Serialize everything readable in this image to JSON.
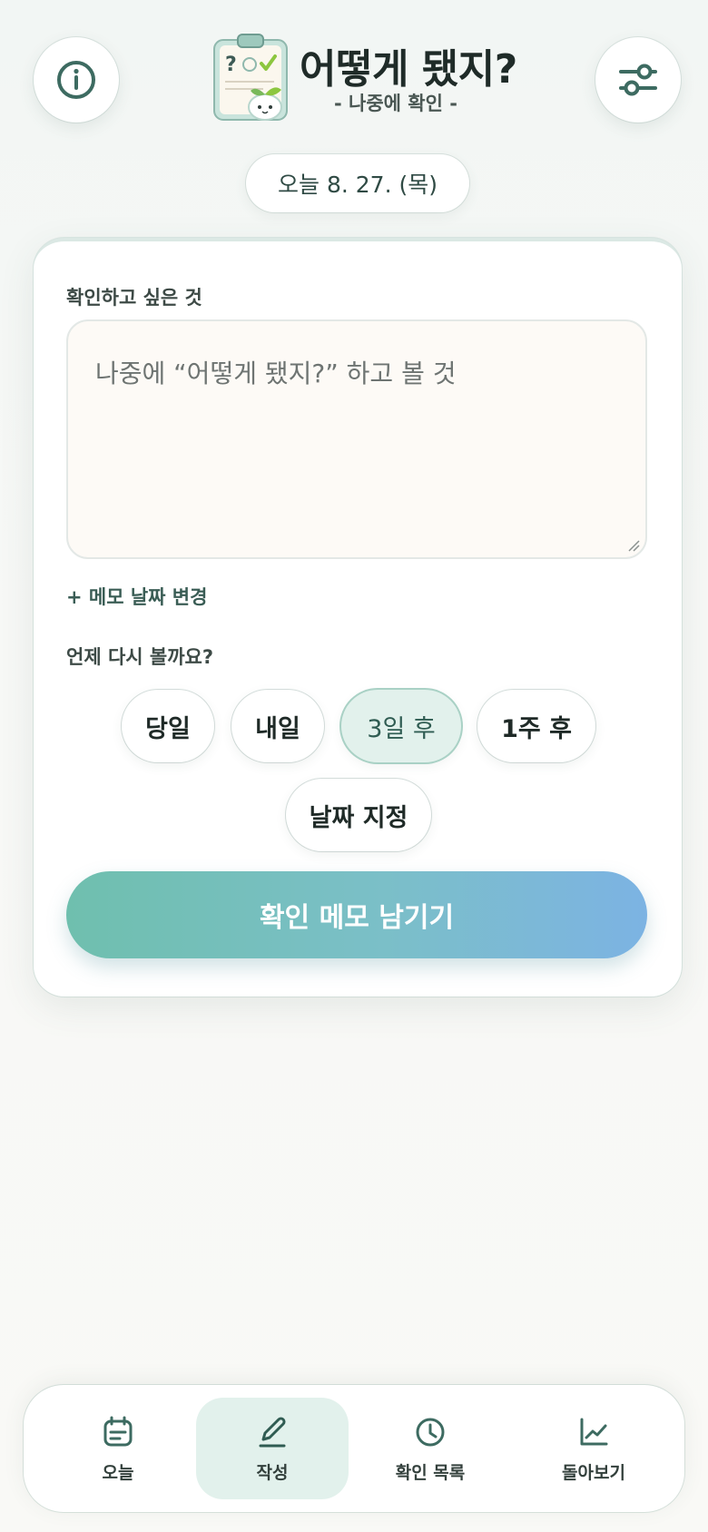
{
  "header": {
    "title": "어떻게 됐지?",
    "subtitle": "- 나중에 확인 -",
    "info_icon": "info-icon",
    "settings_icon": "sliders-icon",
    "logo": "clipboard-sprout-logo"
  },
  "date_pill": "오늘 8. 27. (목)",
  "form": {
    "field_label": "확인하고 싶은 것",
    "memo_placeholder": "나중에 “어떻게 됐지?” 하고 볼 것",
    "memo_value": "",
    "memo_date_link": "+ 메모 날짜 변경",
    "when_label": "언제 다시 볼까요?",
    "options": [
      "당일",
      "내일",
      "3일 후",
      "1주 후",
      "날짜 지정"
    ],
    "selected_option": "3일 후",
    "submit_label": "확인 메모 남기기"
  },
  "nav": {
    "items": [
      {
        "label": "오늘",
        "icon": "calendar-icon"
      },
      {
        "label": "작성",
        "icon": "pencil-icon"
      },
      {
        "label": "확인 목록",
        "icon": "clock-icon"
      },
      {
        "label": "돌아보기",
        "icon": "line-chart-icon"
      }
    ],
    "active": "작성"
  },
  "colors": {
    "accent": "#3d6b61",
    "selected_bg": "#e2f1ec",
    "button_gradient_start": "#6fbfae",
    "button_gradient_end": "#7cb3e3"
  }
}
